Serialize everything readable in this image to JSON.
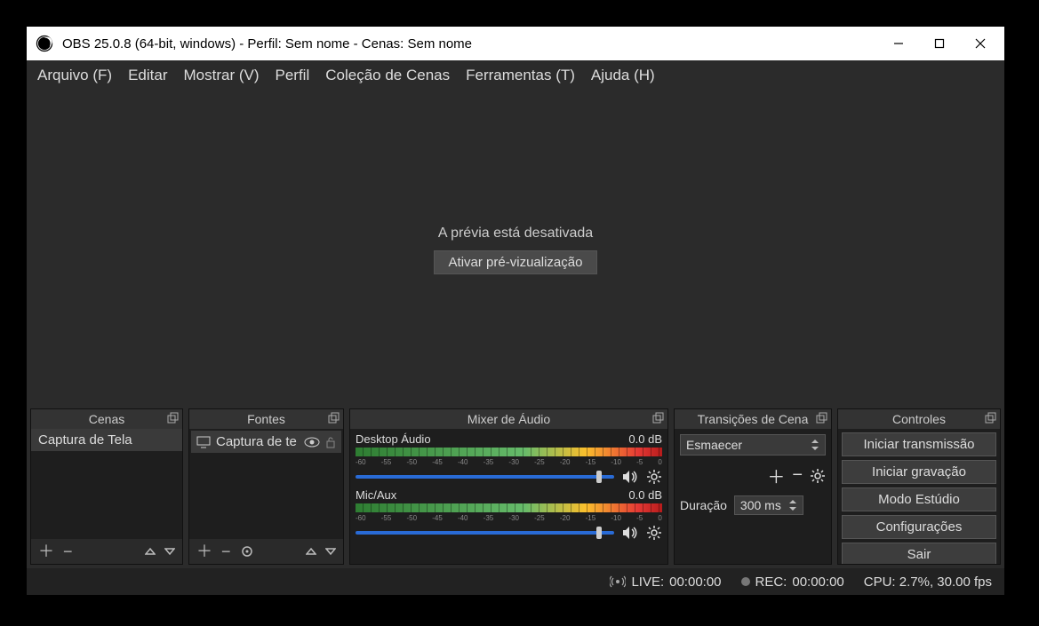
{
  "window": {
    "title": "OBS 25.0.8 (64-bit, windows) - Perfil: Sem nome - Cenas: Sem nome"
  },
  "menu": {
    "file": "Arquivo (F)",
    "edit": "Editar",
    "view": "Mostrar (V)",
    "profile": "Perfil",
    "scene_collection": "Coleção de Cenas",
    "tools": "Ferramentas (T)",
    "help": "Ajuda (H)"
  },
  "preview": {
    "disabled_text": "A prévia está desativada",
    "enable_button": "Ativar pré-vizualização"
  },
  "docks": {
    "scenes": {
      "title": "Cenas",
      "items": [
        "Captura de Tela"
      ]
    },
    "sources": {
      "title": "Fontes",
      "items": [
        "Captura de te"
      ]
    },
    "mixer": {
      "title": "Mixer de Áudio",
      "channels": [
        {
          "name": "Desktop Áudio",
          "level": "0.0 dB"
        },
        {
          "name": "Mic/Aux",
          "level": "0.0 dB"
        }
      ]
    },
    "transitions": {
      "title": "Transições de Cena",
      "current": "Esmaecer",
      "duration_label": "Duração",
      "duration_value": "300 ms"
    },
    "controls": {
      "title": "Controles",
      "buttons": {
        "start_stream": "Iniciar transmissão",
        "start_record": "Iniciar gravação",
        "studio_mode": "Modo Estúdio",
        "settings": "Configurações",
        "exit": "Sair"
      }
    }
  },
  "status": {
    "live_label": "LIVE:",
    "live_time": "00:00:00",
    "rec_label": "REC:",
    "rec_time": "00:00:00",
    "cpu": "CPU: 2.7%, 30.00 fps"
  }
}
